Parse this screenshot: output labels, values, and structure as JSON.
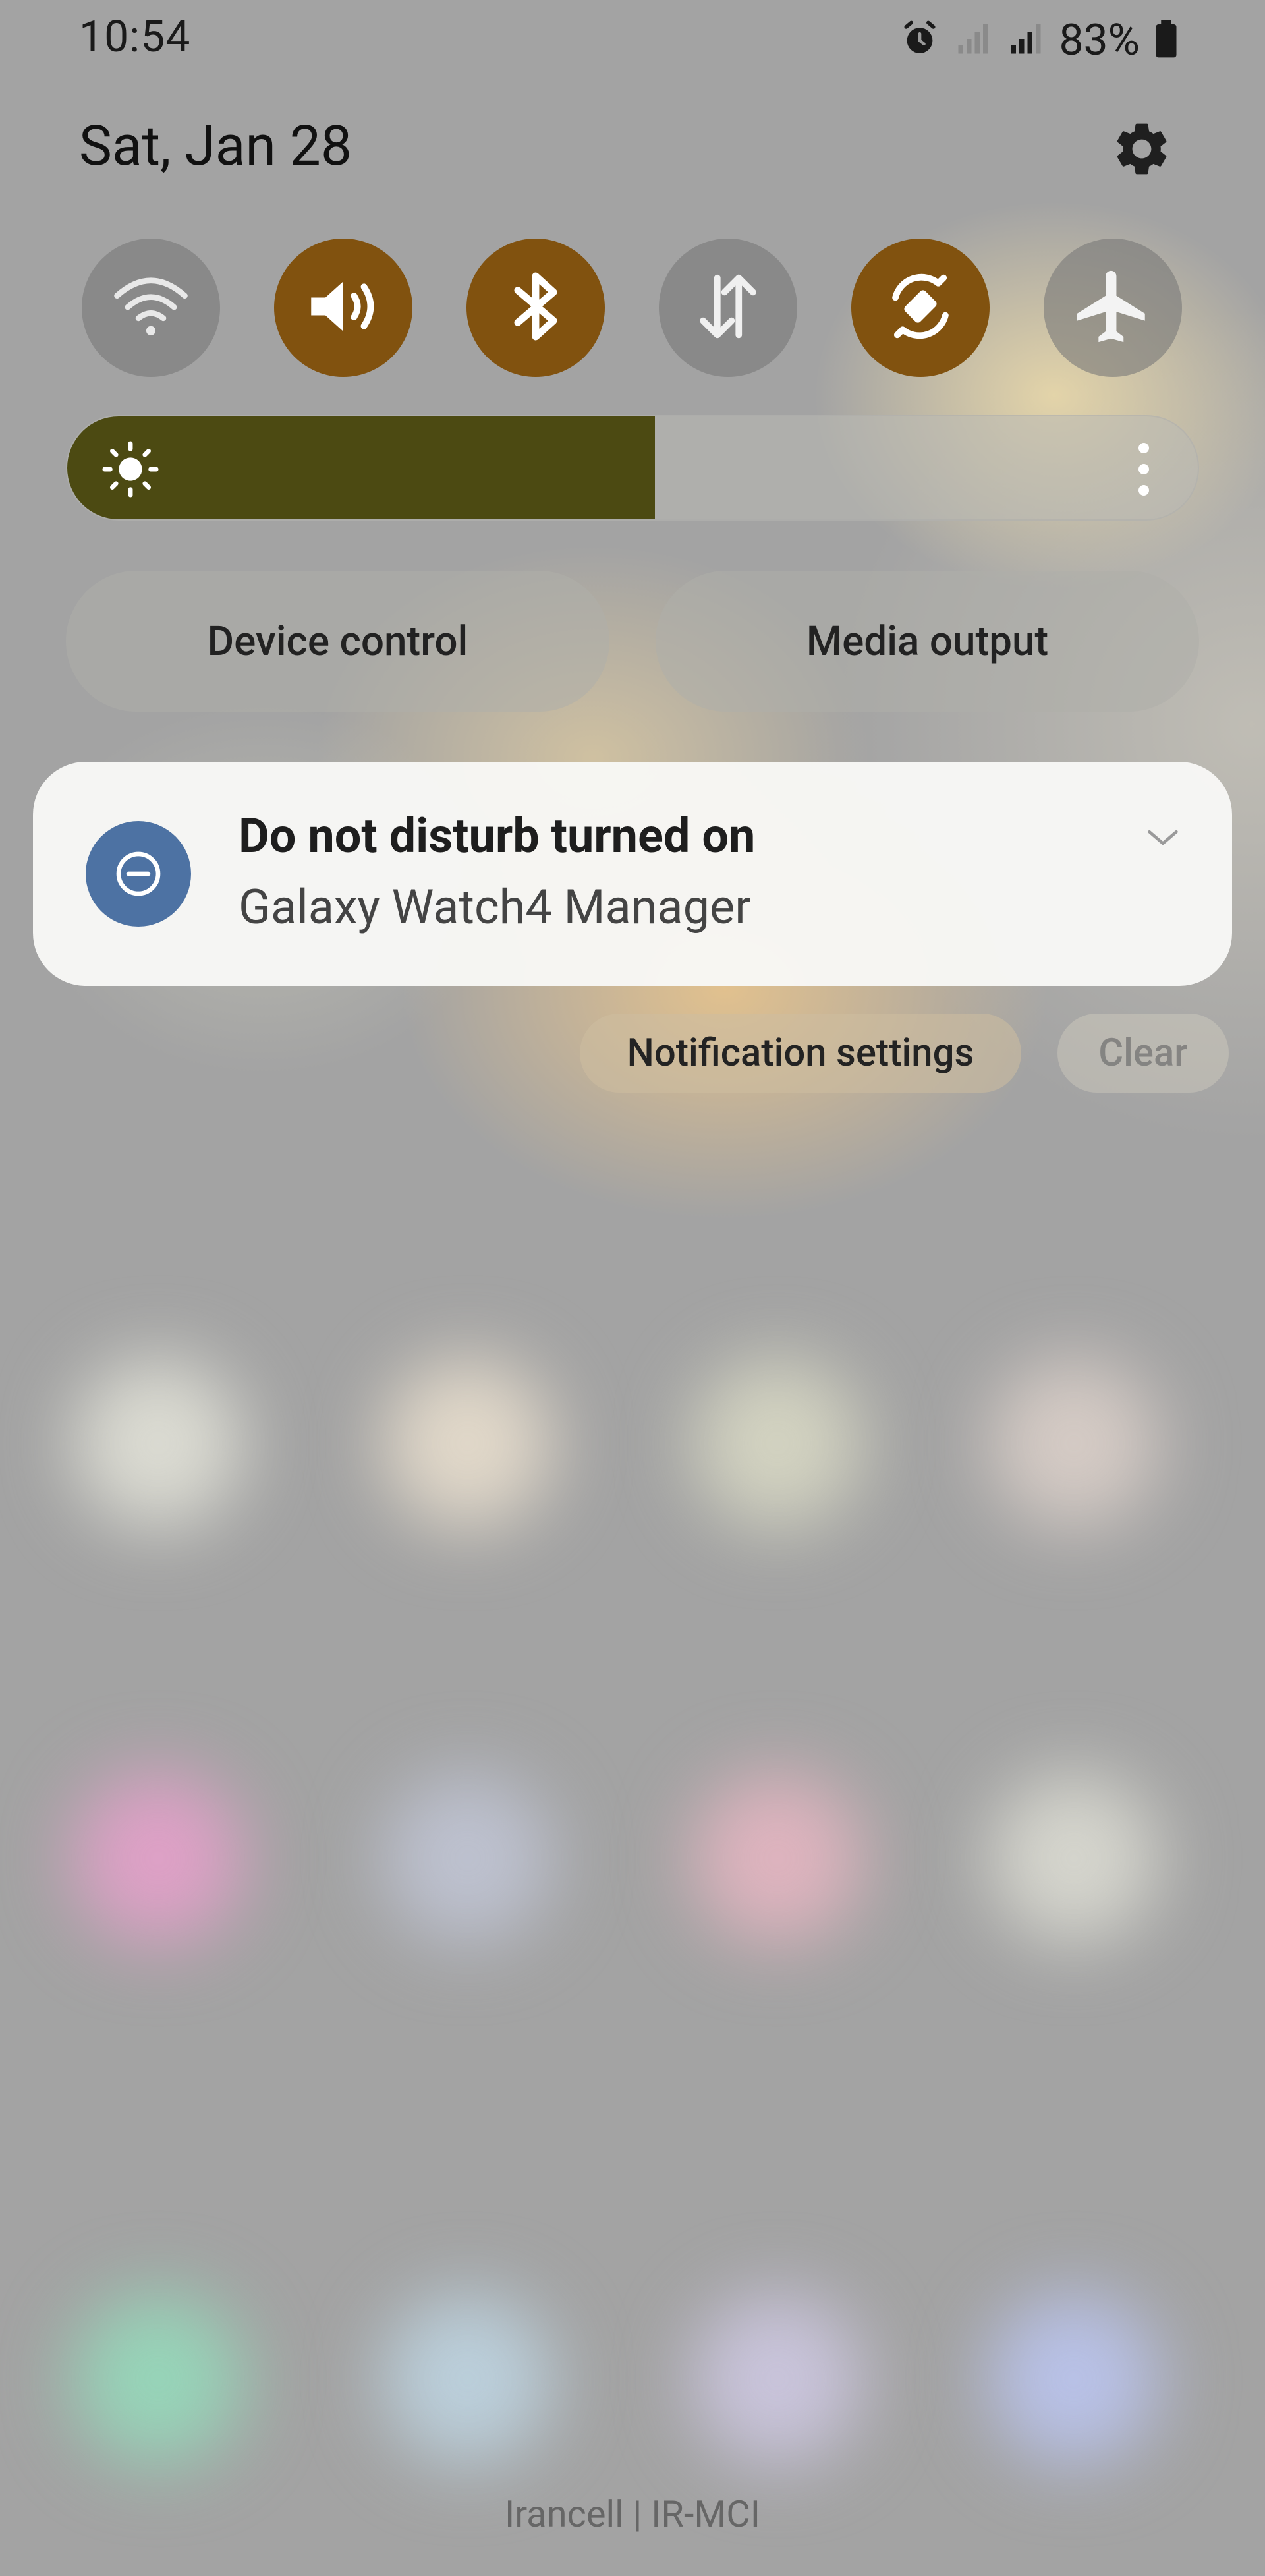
{
  "status_bar": {
    "time": "10:54",
    "battery_percent": "83%",
    "icons": [
      "alarm-icon",
      "signal-icon",
      "signal-icon",
      "battery-icon"
    ]
  },
  "header": {
    "date": "Sat, Jan 28",
    "settings_icon": "gear-icon"
  },
  "quick_toggles": [
    {
      "name": "wifi",
      "icon": "wifi-icon",
      "active": false
    },
    {
      "name": "sound",
      "icon": "volume-icon",
      "active": true
    },
    {
      "name": "bluetooth",
      "icon": "bluetooth-icon",
      "active": true
    },
    {
      "name": "mobile-data",
      "icon": "data-arrows-icon",
      "active": false
    },
    {
      "name": "auto-rotate",
      "icon": "auto-rotate-icon",
      "active": true
    },
    {
      "name": "airplane-mode",
      "icon": "airplane-icon",
      "active": false
    }
  ],
  "brightness": {
    "level_fraction": 0.52,
    "icon": "sun-icon",
    "more_icon": "more-vertical-icon"
  },
  "panel_buttons": {
    "device_control": "Device control",
    "media_output": "Media output"
  },
  "notification": {
    "title": "Do not disturb turned on",
    "app": "Galaxy Watch4 Manager",
    "icon": "do-not-disturb-icon",
    "expand_icon": "chevron-down-icon"
  },
  "notification_actions": {
    "settings_label": "Notification settings",
    "clear_label": "Clear"
  },
  "carrier": "Irancell | IR-MCI",
  "colors": {
    "toggle_on": "#81520f",
    "toggle_off": "#7f7f7f",
    "brightness_fill": "#4c4a12",
    "dnd_icon_bg": "#4d72a3"
  }
}
